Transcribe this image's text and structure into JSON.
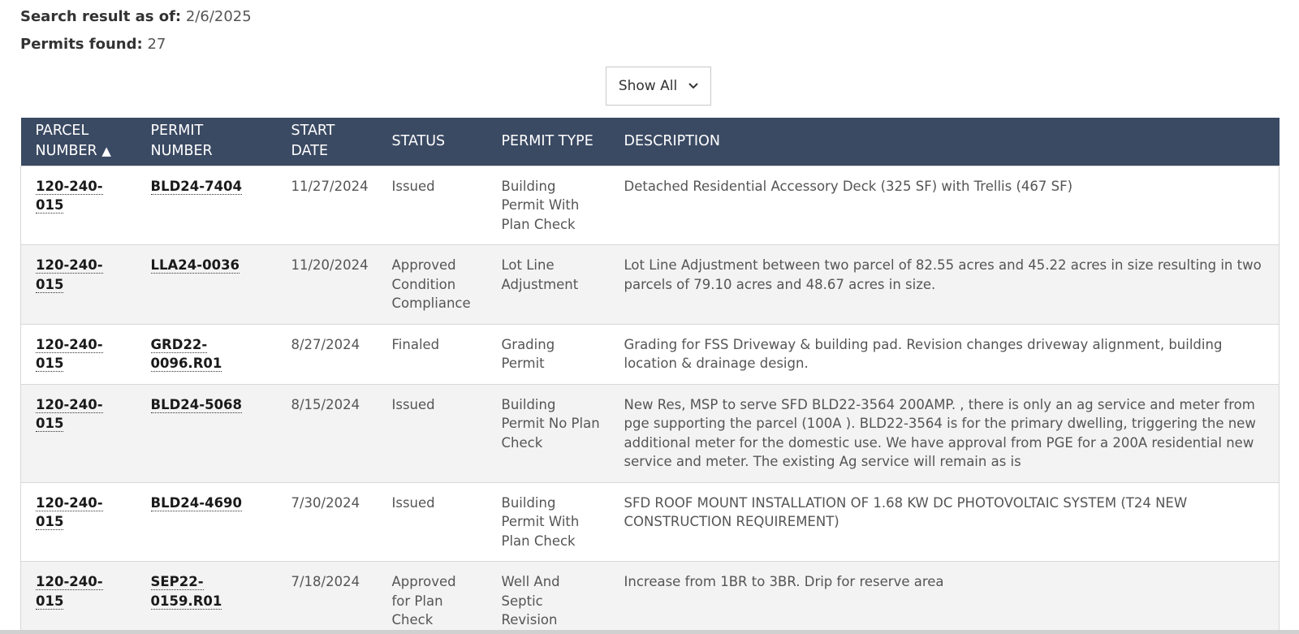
{
  "summary": {
    "date_label": "Search result as of:",
    "date_value": "2/6/2025",
    "count_label": "Permits found:",
    "count_value": "27"
  },
  "filter": {
    "selected": "Show All"
  },
  "table": {
    "headers": {
      "parcel_line1": "PARCEL",
      "parcel_line2": "NUMBER",
      "parcel_sort": "▲",
      "permit_line1": "PERMIT",
      "permit_line2": "NUMBER",
      "start_line1": "START",
      "start_line2": "DATE",
      "status": "STATUS",
      "type": "PERMIT TYPE",
      "description": "DESCRIPTION"
    },
    "rows": [
      {
        "parcel": "120-240-015",
        "permit": "BLD24-7404",
        "date": "11/27/2024",
        "status": "Issued",
        "type": "Building Permit With Plan Check",
        "description": "Detached Residential Accessory Deck (325 SF) with Trellis (467 SF)"
      },
      {
        "parcel": "120-240-015",
        "permit": "LLA24-0036",
        "date": "11/20/2024",
        "status": "Approved Condition Compliance",
        "type": "Lot Line Adjustment",
        "description": "Lot Line Adjustment between two parcel of 82.55 acres and 45.22 acres in size resulting in two parcels of 79.10 acres and 48.67 acres in size."
      },
      {
        "parcel": "120-240-015",
        "permit": "GRD22-0096.R01",
        "date": "8/27/2024",
        "status": "Finaled",
        "type": "Grading Permit",
        "description": "Grading for FSS Driveway & building pad. Revision changes driveway alignment, building location & drainage design."
      },
      {
        "parcel": "120-240-015",
        "permit": "BLD24-5068",
        "date": "8/15/2024",
        "status": "Issued",
        "type": "Building Permit No Plan Check",
        "description": "New Res, MSP to serve SFD BLD22-3564 200AMP. , there is only an ag service and meter from pge supporting the parcel (100A ). BLD22-3564 is for the primary dwelling, triggering the new additional meter for the domestic use. We have approval from PGE for a 200A residential new service and meter. The existing Ag service will remain as is"
      },
      {
        "parcel": "120-240-015",
        "permit": "BLD24-4690",
        "date": "7/30/2024",
        "status": "Issued",
        "type": "Building Permit With Plan Check",
        "description": "SFD ROOF MOUNT INSTALLATION OF 1.68 KW DC PHOTOVOLTAIC SYSTEM (T24 NEW CONSTRUCTION REQUIREMENT)"
      },
      {
        "parcel": "120-240-015",
        "permit": "SEP22-0159.R01",
        "date": "7/18/2024",
        "status": "Approved for Plan Check",
        "type": "Well And Septic Revision",
        "description": "Increase from 1BR to 3BR. Drip for reserve area"
      }
    ]
  }
}
